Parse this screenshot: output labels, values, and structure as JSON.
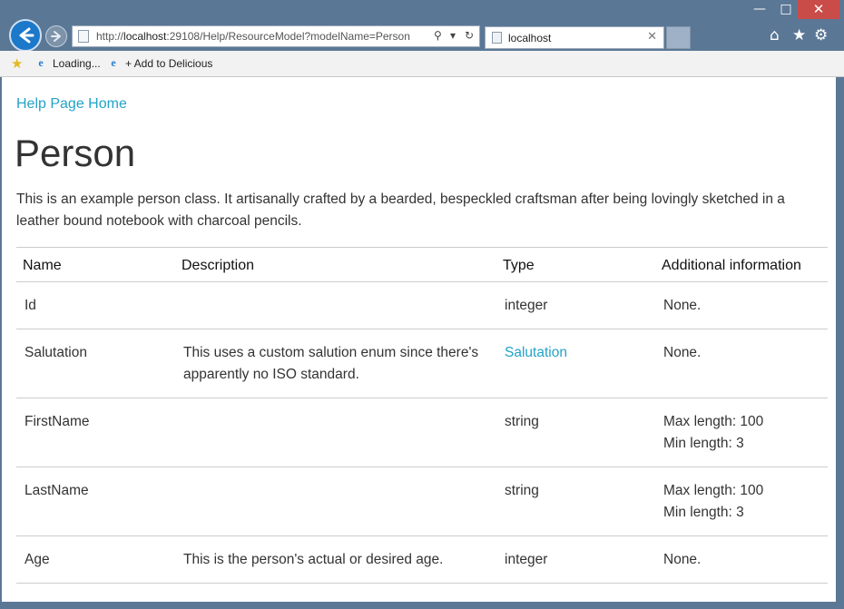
{
  "window": {
    "min_glyph": "—",
    "max_glyph": "□",
    "close_glyph": "✕"
  },
  "address": {
    "url_prefix": "http://",
    "url_host": "localhost",
    "url_rest": ":29108/Help/ResourceModel?modelName=Person",
    "search_glyph": "⚲",
    "dropdown_glyph": "▾",
    "refresh_glyph": "↻"
  },
  "tab": {
    "title": "localhost",
    "close_glyph": "✕"
  },
  "toolbar": {
    "home_glyph": "⌂",
    "favorites_glyph": "★",
    "tools_glyph": "⚙"
  },
  "favorites": {
    "loading_label": "Loading...",
    "delicious_label": "+ Add to Delicious"
  },
  "page": {
    "help_link": "Help Page Home",
    "title": "Person",
    "description": "This is an example person class. It artisanally crafted by a bearded, bespeckled craftsman after being lovingly sketched in a leather bound notebook with charcoal pencils."
  },
  "table": {
    "headers": [
      "Name",
      "Description",
      "Type",
      "Additional information"
    ],
    "rows": [
      {
        "name": "Id",
        "description": "",
        "type": "integer",
        "info1": "None.",
        "info2": ""
      },
      {
        "name": "Salutation",
        "description": "This uses a custom salution enum since there's apparently no ISO standard.",
        "type": "Salutation",
        "info1": "None.",
        "info2": ""
      },
      {
        "name": "FirstName",
        "description": "",
        "type": "string",
        "info1": "Max length: 100",
        "info2": "Min length: 3"
      },
      {
        "name": "LastName",
        "description": "",
        "type": "string",
        "info1": "Max length: 100",
        "info2": "Min length: 3"
      },
      {
        "name": "Age",
        "description": "This is the person's actual or desired age.",
        "type": "integer",
        "info1": "None.",
        "info2": ""
      }
    ]
  },
  "colors": {
    "chrome": "#5b7796",
    "link": "#22a3c7",
    "close_button": "#c94c49"
  }
}
